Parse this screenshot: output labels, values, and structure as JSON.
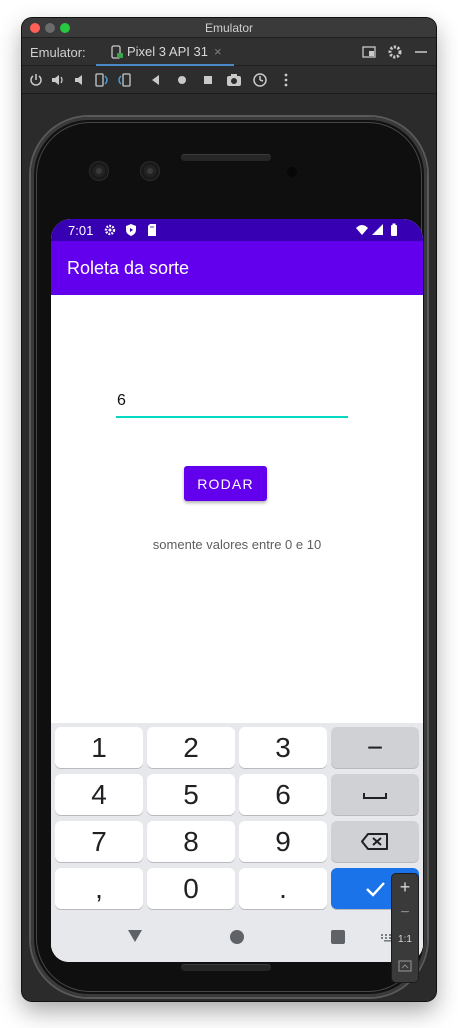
{
  "window": {
    "title": "Emulator",
    "tab_bar_label": "Emulator:",
    "device_tab": "Pixel 3 API 31",
    "tab_close": "×"
  },
  "toolbar": {
    "icons": [
      "power-icon",
      "volume-up-icon",
      "volume-down-icon",
      "rotate-left-icon",
      "rotate-right-icon",
      "back-icon",
      "home-icon",
      "overview-icon",
      "screenshot-icon",
      "snapshot-icon",
      "more-icon"
    ]
  },
  "status_bar": {
    "time": "7:01",
    "icons": [
      "settings-icon",
      "play-protect-icon",
      "sd-card-icon",
      "wifi-icon",
      "signal-icon",
      "battery-icon"
    ]
  },
  "app": {
    "title": "Roleta da sorte",
    "input_value": "6",
    "button_label": "RODAR",
    "hint": "somente valores entre 0 e 10"
  },
  "keyboard": {
    "rows": [
      [
        "1",
        "2",
        "3",
        "−"
      ],
      [
        "4",
        "5",
        "6",
        "␣"
      ],
      [
        "7",
        "8",
        "9",
        "⌫"
      ],
      [
        ",",
        "0",
        ".",
        "✓"
      ]
    ]
  },
  "zoom_panel": {
    "plus": "+",
    "minus": "−",
    "ratio": "1:1"
  },
  "colors": {
    "status_bar": "#3700b3",
    "app_bar": "#6200ee",
    "input_underline": "#03dac5",
    "keyboard_action": "#1a73e8"
  }
}
